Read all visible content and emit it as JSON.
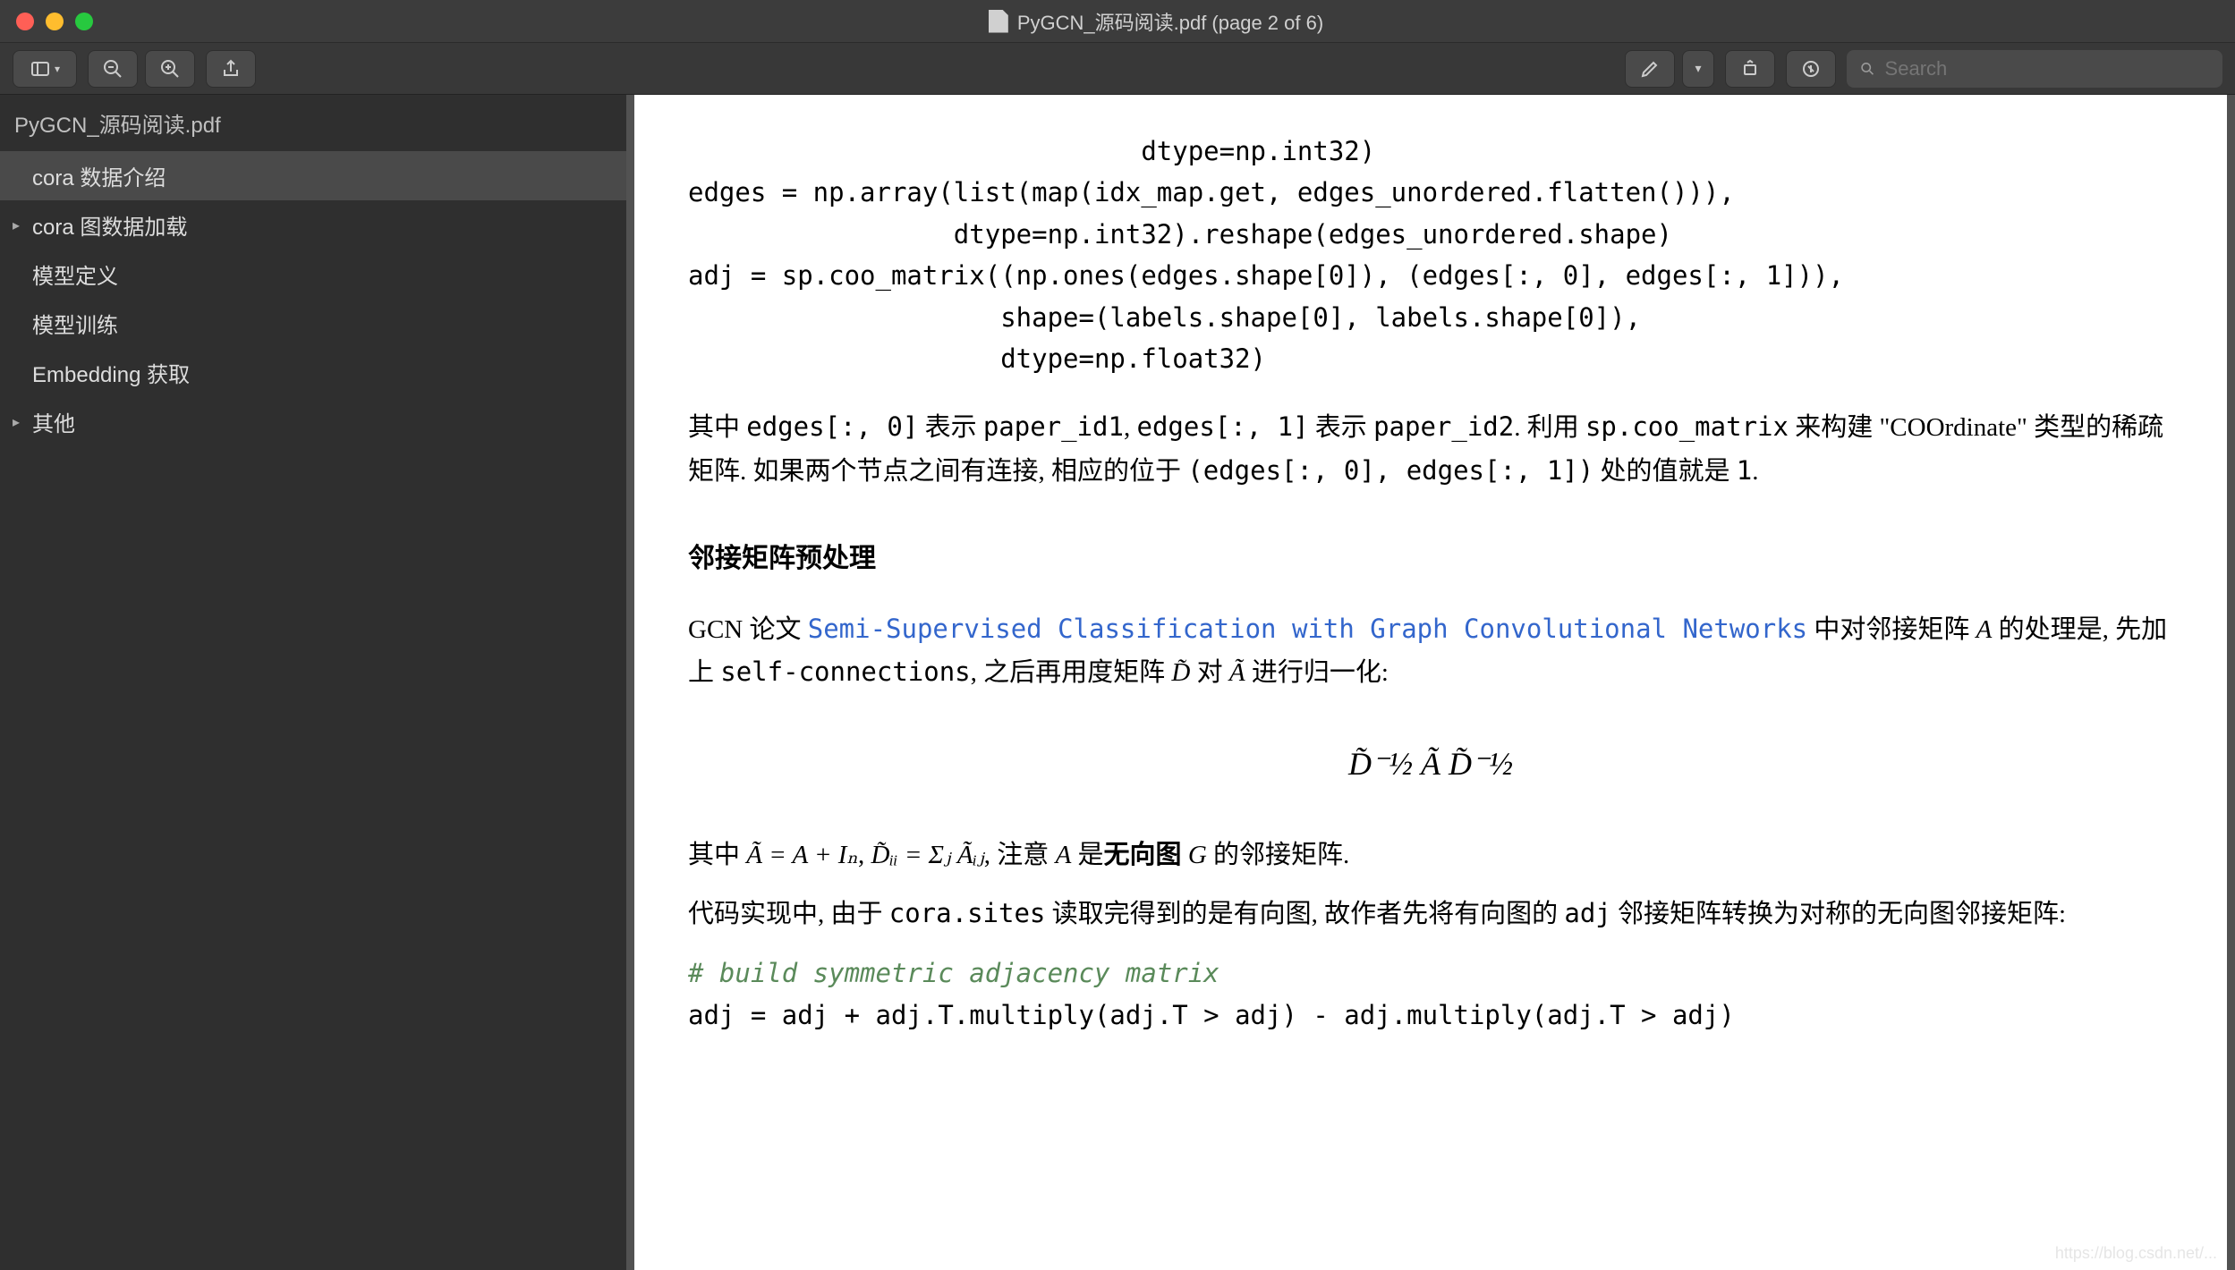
{
  "window": {
    "title": "PyGCN_源码阅读.pdf (page 2 of 6)"
  },
  "toolbar": {
    "search_placeholder": "Search"
  },
  "sidebar": {
    "file": "PyGCN_源码阅读.pdf",
    "items": [
      {
        "label": "cora 数据介绍",
        "selected": true,
        "arrow": false
      },
      {
        "label": "cora 图数据加载",
        "selected": false,
        "arrow": true
      },
      {
        "label": "模型定义",
        "selected": false,
        "arrow": false
      },
      {
        "label": "模型训练",
        "selected": false,
        "arrow": false
      },
      {
        "label": "Embedding 获取",
        "selected": false,
        "arrow": false
      },
      {
        "label": "其他",
        "selected": false,
        "arrow": true
      }
    ]
  },
  "doc": {
    "code1": "                             dtype=np.int32)\nedges = np.array(list(map(idx_map.get, edges_unordered.flatten())),\n                 dtype=np.int32).reshape(edges_unordered.shape)\nadj = sp.coo_matrix((np.ones(edges.shape[0]), (edges[:, 0], edges[:, 1])),\n                    shape=(labels.shape[0], labels.shape[0]),\n                    dtype=np.float32)",
    "para1_a": "其中 ",
    "para1_b": "edges[:, 0]",
    "para1_c": " 表示 ",
    "para1_d": "paper_id1",
    "para1_e": ", ",
    "para1_f": "edges[:, 1]",
    "para1_g": " 表示 ",
    "para1_h": "paper_id2",
    "para1_i": ".  利用 ",
    "para1_j": "sp.coo_matrix",
    "para1_k": " 来构建 \"COOrdinate\" 类型的稀疏矩阵.  如果两个节点之间有连接, 相应的位于 ",
    "para1_l": "(edges[:, 0], edges[:, 1])",
    "para1_m": " 处的值就是 ",
    "para1_n": "1",
    "para1_o": ".",
    "heading1": "邻接矩阵预处理",
    "para2_a": "GCN 论文 ",
    "para2_link": "Semi-Supervised Classification with Graph Convolutional Networks",
    "para2_b": " 中对邻接矩阵 ",
    "para2_c": "A",
    "para2_d": " 的处理是, 先加上 ",
    "para2_e": "self-connections",
    "para2_f": ", 之后再用度矩阵 ",
    "para2_g": "D̃",
    "para2_h": " 对 ",
    "para2_i": "Ã",
    "para2_j": " 进行归一化:",
    "formula1": "D̃⁻½ Ã D̃⁻½",
    "para3_a": "其中 ",
    "para3_b": "Ã = A + Iₙ",
    "para3_c": ", ",
    "para3_d": "D̃ᵢᵢ = Σⱼ Ãᵢⱼ",
    "para3_e": ", 注意 ",
    "para3_f": "A",
    "para3_g": " 是",
    "para3_bold": "无向图",
    "para3_h": " ",
    "para3_i": "G",
    "para3_j": " 的邻接矩阵.",
    "para4_a": "代码实现中, 由于 ",
    "para4_b": "cora.sites",
    "para4_c": " 读取完得到的是有向图, 故作者先将有向图的 ",
    "para4_d": "adj",
    "para4_e": " 邻接矩阵转换为对称的无向图邻接矩阵:",
    "comment1": "# build symmetric adjacency matrix",
    "code2": "adj = adj + adj.T.multiply(adj.T > adj) - adj.multiply(adj.T > adj)"
  },
  "watermark": "https://blog.csdn.net/..."
}
